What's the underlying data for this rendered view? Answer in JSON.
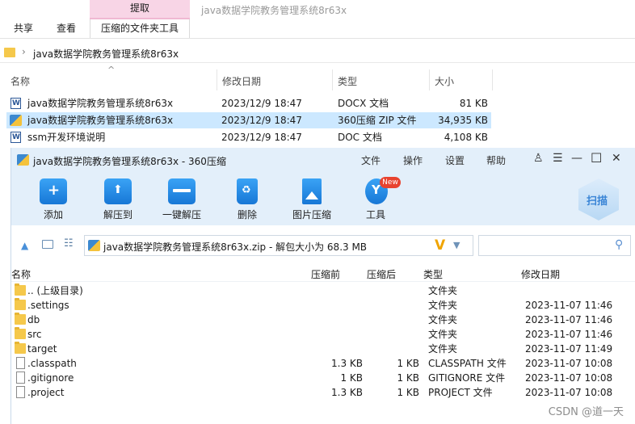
{
  "ribbon": {
    "context_tab": "提取",
    "window_title": "java数据学院教务管理系统8r63x",
    "tabs": [
      "共享",
      "查看",
      "压缩的文件夹工具"
    ]
  },
  "address": {
    "path": "java数据学院教务管理系统8r63x",
    "separator": "›"
  },
  "explorer_list": {
    "headers": [
      "名称",
      "修改日期",
      "类型",
      "大小"
    ],
    "files": [
      {
        "name": "java数据学院教务管理系统8r63x",
        "date": "2023/12/9 18:47",
        "type": "DOCX 文档",
        "size": "81 KB",
        "icon": "word-doc-icon"
      },
      {
        "name": "java数据学院教务管理系统8r63x",
        "date": "2023/12/9 18:47",
        "type": "360压缩 ZIP 文件",
        "size": "34,935 KB",
        "icon": "zip-archive-icon"
      },
      {
        "name": "ssm开发环境说明",
        "date": "2023/12/9 18:47",
        "type": "DOC 文档",
        "size": "4,108 KB",
        "icon": "word-doc-icon"
      }
    ]
  },
  "zip_window": {
    "title": "java数据学院教务管理系统8r63x - 360压缩",
    "menus": [
      "文件",
      "操作",
      "设置",
      "帮助"
    ],
    "toolbar": [
      "添加",
      "解压到",
      "一键解压",
      "删除",
      "图片压缩",
      "工具"
    ],
    "new_badge": "New",
    "scan_label": "扫描",
    "path_text": "java数据学院教务管理系统8r63x.zip - 解包大小为 68.3 MB",
    "search_placeholder": "",
    "headers": [
      "名称",
      "压缩前",
      "压缩后",
      "类型",
      "修改日期"
    ],
    "rows": [
      {
        "name": ".. (上级目录)",
        "before": "",
        "after": "",
        "type": "文件夹",
        "date": "",
        "icon": "folder"
      },
      {
        "name": ".settings",
        "before": "",
        "after": "",
        "type": "文件夹",
        "date": "2023-11-07 11:46",
        "icon": "folder"
      },
      {
        "name": "db",
        "before": "",
        "after": "",
        "type": "文件夹",
        "date": "2023-11-07 11:46",
        "icon": "folder"
      },
      {
        "name": "src",
        "before": "",
        "after": "",
        "type": "文件夹",
        "date": "2023-11-07 11:46",
        "icon": "folder"
      },
      {
        "name": "target",
        "before": "",
        "after": "",
        "type": "文件夹",
        "date": "2023-11-07 11:49",
        "icon": "folder"
      },
      {
        "name": ".classpath",
        "before": "1.3 KB",
        "after": "1 KB",
        "type": "CLASSPATH 文件",
        "date": "2023-11-07 10:08",
        "icon": "file"
      },
      {
        "name": ".gitignore",
        "before": "1 KB",
        "after": "1 KB",
        "type": "GITIGNORE 文件",
        "date": "2023-11-07 10:08",
        "icon": "file"
      },
      {
        "name": ".project",
        "before": "1.3 KB",
        "after": "1 KB",
        "type": "PROJECT 文件",
        "date": "2023-11-07 10:08",
        "icon": "file"
      }
    ]
  },
  "watermark": "CSDN @道一天",
  "colors": {
    "selection": "#cce8ff",
    "context_tab": "#f8d5e6",
    "zip_chrome": "#e3effa",
    "accent": "#1777d6"
  }
}
